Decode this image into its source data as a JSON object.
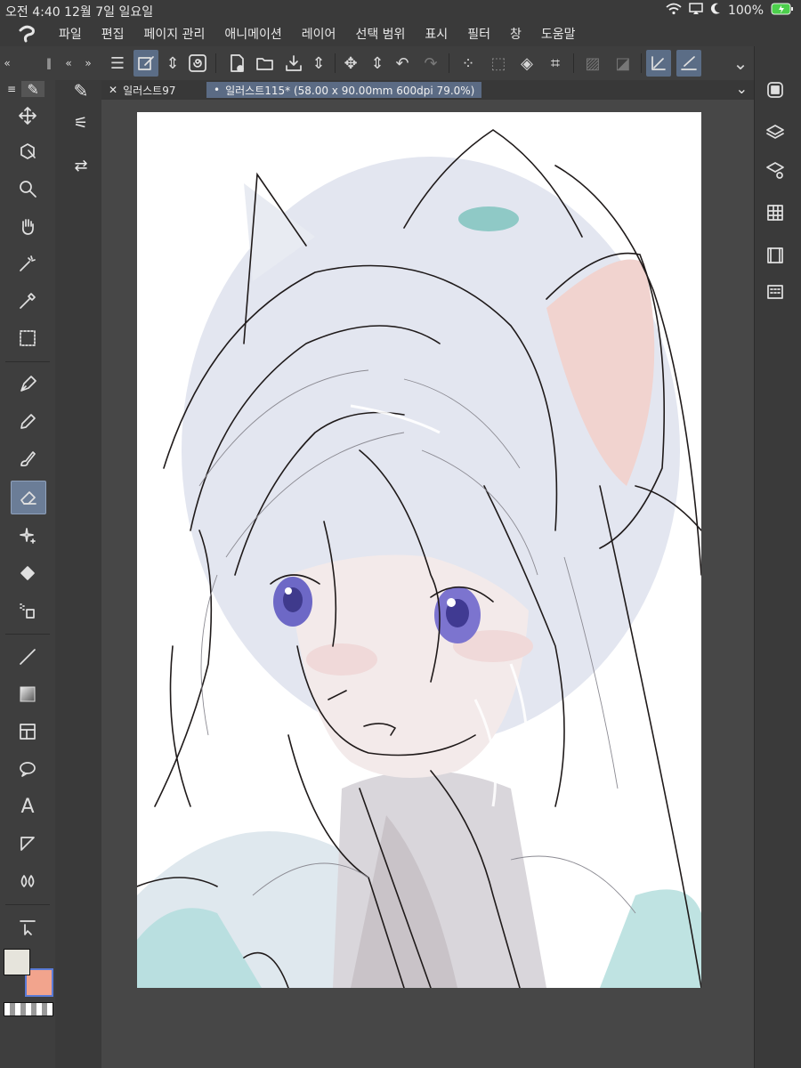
{
  "status": {
    "time_date": "오전 4:40   12월 7일 일요일",
    "battery": "100%"
  },
  "menu": {
    "items": [
      "파일",
      "편집",
      "페이지 관리",
      "애니메이션",
      "레이어",
      "선택 범위",
      "표시",
      "필터",
      "창",
      "도움말"
    ]
  },
  "tabs": [
    {
      "label": "일러스트97",
      "active": false
    },
    {
      "label": "일러스트115* (58.00 x 90.00mm 600dpi 79.0%)",
      "active": true
    }
  ],
  "colors": {
    "main": "#e6e4dc",
    "sub": "#f2a48d",
    "accent": "#6b7d97"
  },
  "tools": [
    "move-icon",
    "object-select-icon",
    "zoom-icon",
    "hand-icon",
    "magic-wand-icon",
    "eyedropper-icon",
    "selection-icon",
    "pen-icon",
    "pencil-icon",
    "brush-icon",
    "eraser-icon",
    "sparkle-decoration-icon",
    "fill-icon",
    "airbrush-icon",
    "line-figure-icon",
    "gradient-icon",
    "frame-border-icon",
    "speech-balloon-icon",
    "text-icon",
    "ruler-icon",
    "blend-icon",
    "operation-icon"
  ]
}
